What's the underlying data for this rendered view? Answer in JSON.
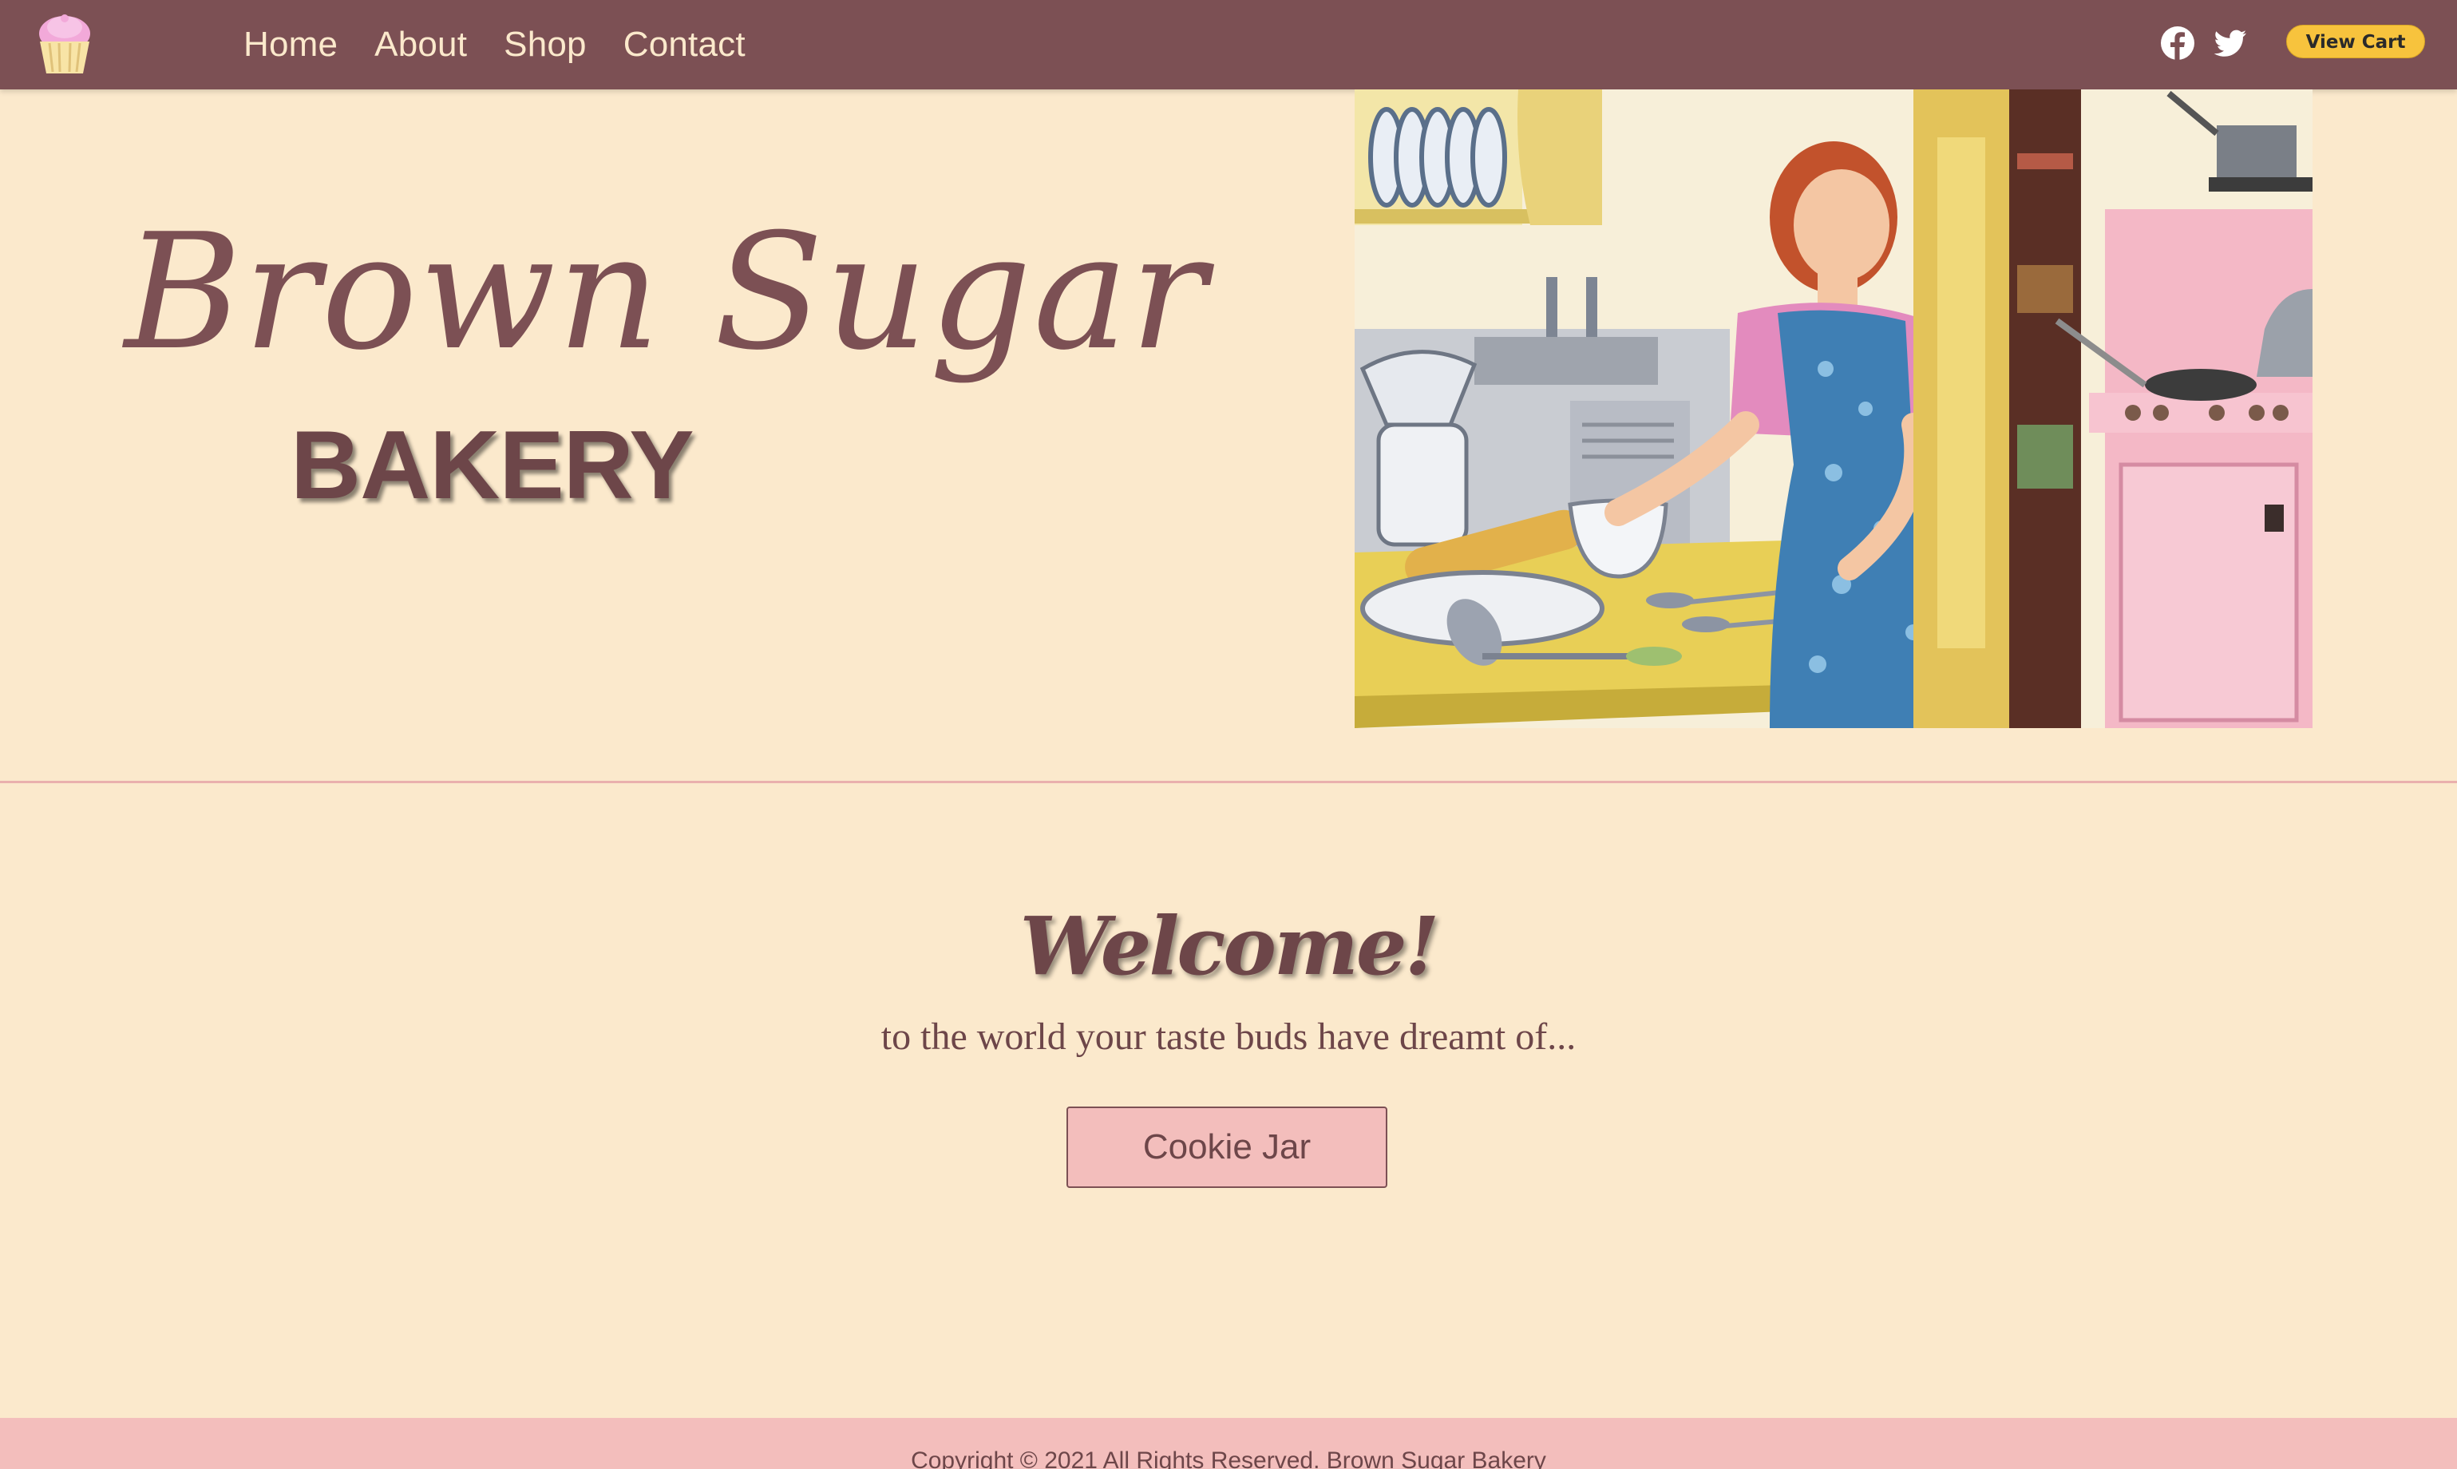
{
  "nav": {
    "links": [
      "Home",
      "About",
      "Shop",
      "Contact"
    ],
    "view_cart_label": "View Cart"
  },
  "hero": {
    "brand_script": "Brown Sugar",
    "brand_sub": "BAKERY"
  },
  "welcome": {
    "heading": "Welcome!",
    "tagline": "to the world your taste buds have dreamt of...",
    "button_label": "Cookie Jar"
  },
  "footer": {
    "text": "Copyright © 2021 All Rights Reserved. Brown Sugar Bakery"
  },
  "icons": {
    "logo": "cupcake-icon",
    "social": [
      "facebook-icon",
      "twitter-icon"
    ]
  },
  "colors": {
    "nav_bg": "#7c5054",
    "page_bg": "#fbe9cc",
    "accent_pink": "#f3bebc",
    "cart_yellow": "#f7c33d",
    "text_brown": "#6d4649"
  }
}
